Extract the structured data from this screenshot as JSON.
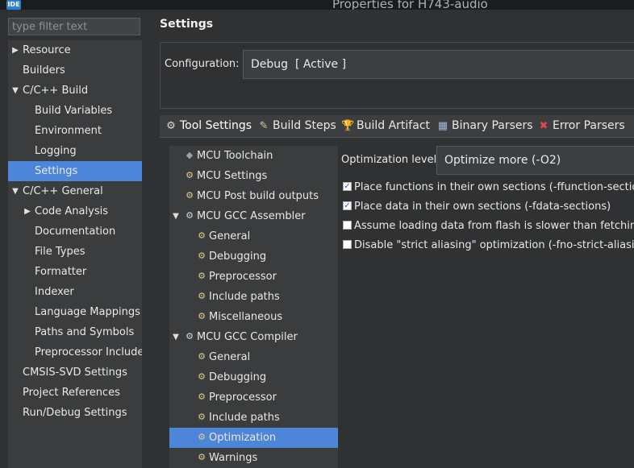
{
  "window": {
    "app_logo": "IDE",
    "title": "Properties for H743-audio"
  },
  "filter": {
    "placeholder": "type filter text"
  },
  "nav": {
    "items": [
      {
        "label": "Resource",
        "caret": "right"
      },
      {
        "label": "Builders",
        "caret": ""
      },
      {
        "label": "C/C++ Build",
        "caret": "down"
      },
      {
        "label": "Build Variables",
        "caret": ""
      },
      {
        "label": "Environment",
        "caret": ""
      },
      {
        "label": "Logging",
        "caret": ""
      },
      {
        "label": "Settings",
        "caret": "",
        "selected": true
      },
      {
        "label": "C/C++ General",
        "caret": "down"
      },
      {
        "label": "Code Analysis",
        "caret": "right"
      },
      {
        "label": "Documentation",
        "caret": ""
      },
      {
        "label": "File Types",
        "caret": ""
      },
      {
        "label": "Formatter",
        "caret": ""
      },
      {
        "label": "Indexer",
        "caret": ""
      },
      {
        "label": "Language Mappings",
        "caret": ""
      },
      {
        "label": "Paths and Symbols",
        "caret": ""
      },
      {
        "label": "Preprocessor Include",
        "caret": ""
      },
      {
        "label": "CMSIS-SVD Settings",
        "caret": ""
      },
      {
        "label": "Project References",
        "caret": ""
      },
      {
        "label": "Run/Debug Settings",
        "caret": ""
      }
    ]
  },
  "main": {
    "title": "Settings",
    "configuration": {
      "label": "Configuration:",
      "value": "Debug  [ Active ]"
    },
    "tabs": [
      {
        "label": "Tool Settings",
        "icon": "tool-settings-icon",
        "active": true
      },
      {
        "label": "Build Steps",
        "icon": "build-steps-icon"
      },
      {
        "label": "Build Artifact",
        "icon": "trophy-icon"
      },
      {
        "label": "Binary Parsers",
        "icon": "binary-parsers-icon"
      },
      {
        "label": "Error Parsers",
        "icon": "error-icon"
      }
    ],
    "tool_tree": [
      {
        "label": "MCU Toolchain",
        "icon": "toolchain-icon"
      },
      {
        "label": "MCU Settings",
        "icon": "settings-icon"
      },
      {
        "label": "MCU Post build outputs",
        "icon": "settings-icon"
      },
      {
        "label": "MCU GCC Assembler",
        "icon": "gear-icon",
        "caret": "down"
      },
      {
        "label": "General",
        "icon": "settings-icon"
      },
      {
        "label": "Debugging",
        "icon": "settings-icon"
      },
      {
        "label": "Preprocessor",
        "icon": "settings-icon"
      },
      {
        "label": "Include paths",
        "icon": "settings-icon"
      },
      {
        "label": "Miscellaneous",
        "icon": "settings-icon"
      },
      {
        "label": "MCU GCC Compiler",
        "icon": "gear-icon",
        "caret": "down"
      },
      {
        "label": "General",
        "icon": "settings-icon"
      },
      {
        "label": "Debugging",
        "icon": "settings-icon"
      },
      {
        "label": "Preprocessor",
        "icon": "settings-icon"
      },
      {
        "label": "Include paths",
        "icon": "settings-icon"
      },
      {
        "label": "Optimization",
        "icon": "settings-icon",
        "selected": true
      },
      {
        "label": "Warnings",
        "icon": "settings-icon"
      }
    ],
    "optimization": {
      "label": "Optimization level",
      "value": "Optimize more (-O2)"
    },
    "options": [
      {
        "label": "Place functions in their own sections (-ffunction-sections)",
        "checked": true
      },
      {
        "label": "Place data in their own sections (-fdata-sections)",
        "checked": true
      },
      {
        "label": "Assume loading data from flash is slower than fetching in",
        "checked": false
      },
      {
        "label": "Disable \"strict aliasing\" optimization (-fno-strict-aliasing)",
        "checked": false
      }
    ]
  }
}
